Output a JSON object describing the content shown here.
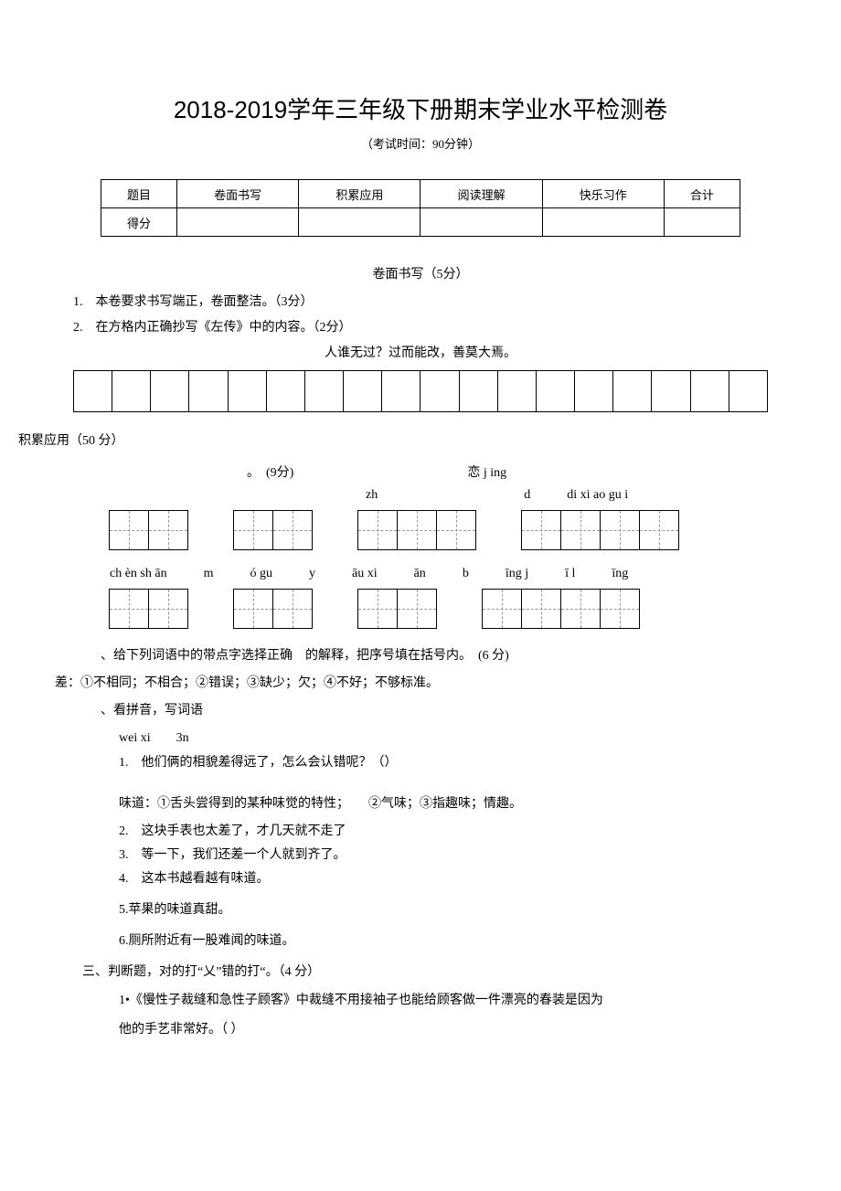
{
  "title": "2018-2019学年三年级下册期末学业水平检测卷",
  "subtitle": "（考试时间：90分钟）",
  "scoreTable": {
    "headers": [
      "题目",
      "卷面书写",
      "积累应用",
      "阅读理解",
      "快乐习作",
      "合计"
    ],
    "row2": "得分"
  },
  "sectionWriting": {
    "title": "卷面书写（5分）",
    "item1": "1.　本卷要求书写端正，卷面整洁。（3分）",
    "item2": "2.　在方格内正确抄写《左传》中的内容。（2分）",
    "quote": "人谁无过？过而能改，善莫大焉。"
  },
  "sectionAccum": {
    "label": "积累应用（50 分）",
    "q1_mark": "。　(9分)",
    "pinyin_row1": [
      "。",
      "恋 j ing"
    ],
    "pinyin_row2": [
      "zh",
      "d",
      "di xi ao gu i"
    ],
    "pinyin_row3": [
      "ch èn sh ān",
      "m",
      "ó gu",
      "y",
      "āu xi",
      "ān",
      "b",
      "īng j",
      "ī l",
      "īng"
    ],
    "q2_title": "、给下列词语中的带点字选择正确　的解释，把序号填在括号内。　(6 分)",
    "def_cha": "差：①不相同；不相合；②错误；③缺少；欠；④不好；不够标准。",
    "q1b_title": "、看拼音，写词语",
    "q1b_pinyin": "wei xi　　3n",
    "item_1": "1.　他们俩的相貌差得远了，怎么会认错呢？（）",
    "def_wei": "味道：①舌头尝得到的某种味觉的特性；　　②气味；③指趣味；情趣。",
    "item_2": "2.　这块手表也太差了，才几天就不走了",
    "item_3": "3.　等一下，我们还差一个人就到齐了。",
    "item_4": "4.　这本书越看越有味道。",
    "item_5": "5.苹果的味道真甜。",
    "item_6": "6.厕所附近有一股难闻的味道。"
  },
  "sectionJudge": {
    "title": "三、判断题，对的打“乂”错的打“。（4 分）",
    "item1_a": "1•《慢性子裁缝和急性子顾客》中裁缝不用接袖子也能给顾客做一件漂亮的春装是因为",
    "item1_b": "他的手艺非常好。（ ）"
  }
}
